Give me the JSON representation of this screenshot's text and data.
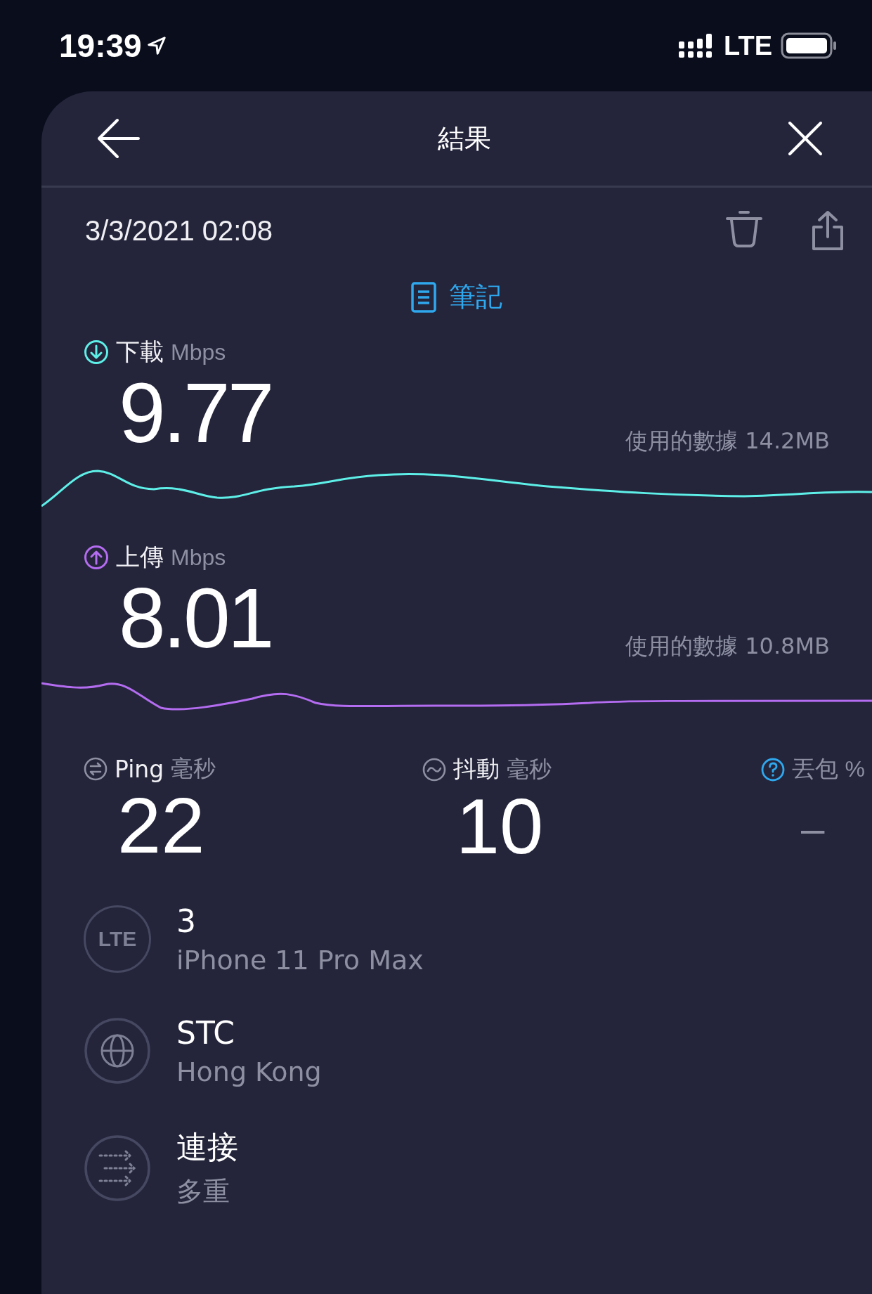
{
  "status_bar": {
    "time": "19:39",
    "network": "LTE",
    "location_on": true
  },
  "header": {
    "title": "結果"
  },
  "result": {
    "date": "3/3/2021 02:08",
    "notes_label": "筆記"
  },
  "speeds": [
    {
      "kind": "download",
      "label": "下載",
      "unit": "Mbps",
      "value": "9.77",
      "data_used": "使用的數據 14.2MB"
    },
    {
      "kind": "upload",
      "label": "上傳",
      "unit": "Mbps",
      "value": "8.01",
      "data_used": "使用的數據 10.8MB"
    }
  ],
  "metrics": [
    {
      "kind": "ping",
      "label": "Ping",
      "unit": "毫秒",
      "value": "22",
      "disabled": false
    },
    {
      "kind": "jitter",
      "label": "抖動",
      "unit": "毫秒",
      "value": "10",
      "disabled": false
    },
    {
      "kind": "packet_loss",
      "label": "丟包",
      "unit": "%",
      "value": "–",
      "disabled": true
    }
  ],
  "details": [
    {
      "kind": "lte",
      "icon_text": "LTE",
      "title": "3",
      "subtitle": "iPhone 11 Pro Max"
    },
    {
      "kind": "server",
      "title": "STC",
      "subtitle": "Hong Kong"
    },
    {
      "kind": "connections",
      "title": "連接",
      "subtitle": "多重"
    }
  ]
}
